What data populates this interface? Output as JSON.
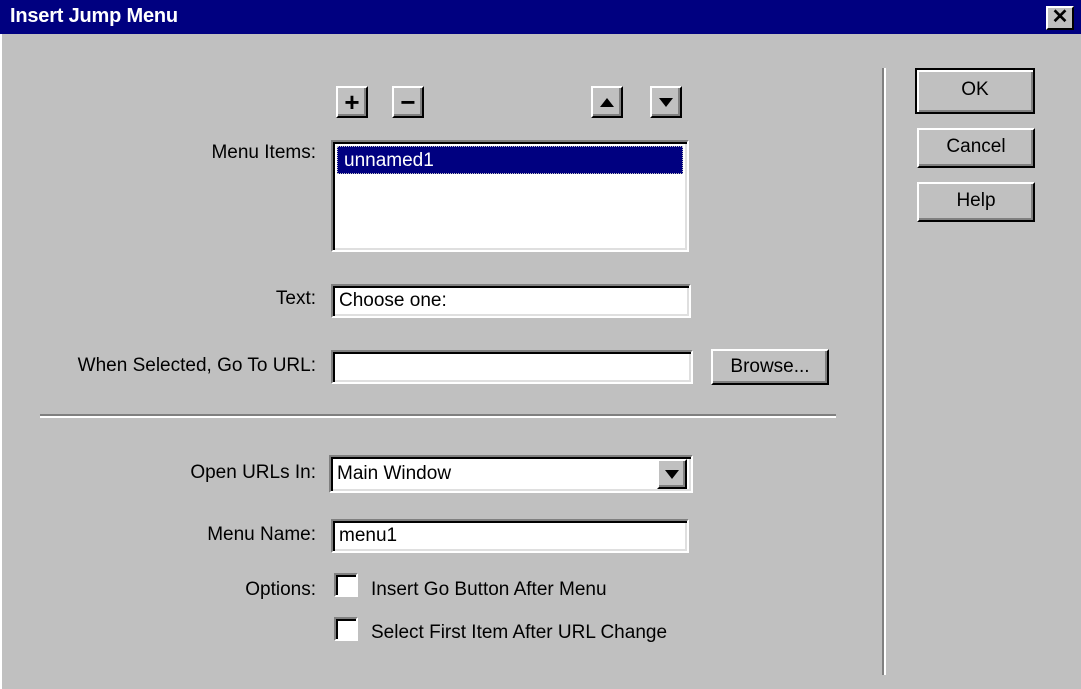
{
  "window": {
    "title": "Insert Jump Menu",
    "close_glyph": "✕"
  },
  "toolbar": {
    "add_label": "+",
    "remove_label": "−",
    "move_up_icon": "triangle-up-icon",
    "move_down_icon": "triangle-down-icon"
  },
  "menu_items": {
    "label": "Menu Items:",
    "items": [
      "unnamed1"
    ],
    "selected_index": 0
  },
  "text_field": {
    "label": "Text:",
    "value": "Choose one:"
  },
  "url_field": {
    "label": "When Selected, Go To URL:",
    "value": "",
    "browse_label": "Browse..."
  },
  "open_urls": {
    "label": "Open URLs In:",
    "selected": "Main Window"
  },
  "menu_name": {
    "label": "Menu Name:",
    "value": "menu1"
  },
  "options": {
    "label": "Options:",
    "insert_go_button": {
      "label": "Insert Go Button After Menu",
      "checked": false
    },
    "select_first_item": {
      "label": "Select First Item After URL Change",
      "checked": false
    }
  },
  "buttons": {
    "ok": "OK",
    "cancel": "Cancel",
    "help": "Help"
  }
}
